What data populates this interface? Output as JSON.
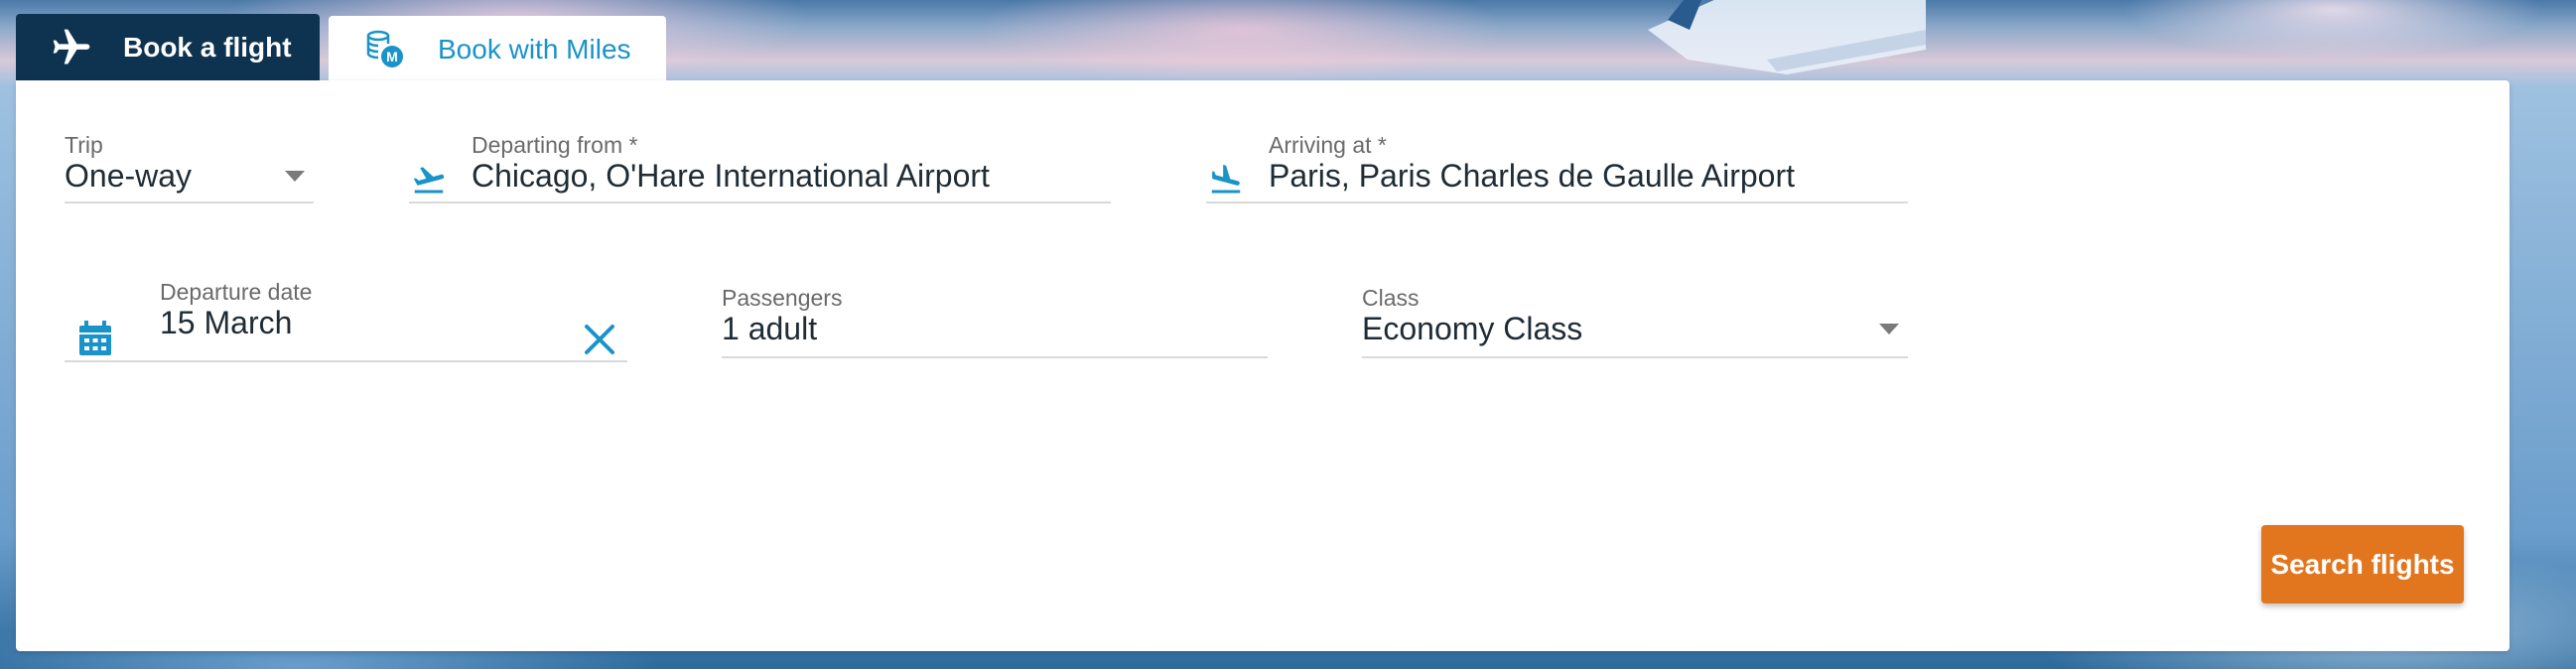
{
  "tabs": [
    {
      "label": "Book a flight",
      "icon": "plane-icon",
      "active": false
    },
    {
      "label": "Book with Miles",
      "icon": "miles-coins-icon",
      "active": true
    }
  ],
  "form": {
    "trip": {
      "label": "Trip",
      "value": "One-way"
    },
    "departing": {
      "label": "Departing from *",
      "value": "Chicago, O'Hare International Airport",
      "icon": "plane-takeoff-icon"
    },
    "arriving": {
      "label": "Arriving at *",
      "value": "Paris, Paris Charles de Gaulle Airport",
      "icon": "plane-landing-icon"
    },
    "departure_date": {
      "label": "Departure date",
      "value": "15 March",
      "icon": "calendar-icon",
      "clear_icon": "close-icon"
    },
    "passengers": {
      "label": "Passengers",
      "value": "1 adult"
    },
    "class": {
      "label": "Class",
      "value": "Economy Class"
    }
  },
  "search_button": {
    "label": "Search flights"
  },
  "colors": {
    "dark_tab": "#0d3350",
    "accent_blue": "#1a93c9",
    "button_orange": "#e2761f"
  }
}
